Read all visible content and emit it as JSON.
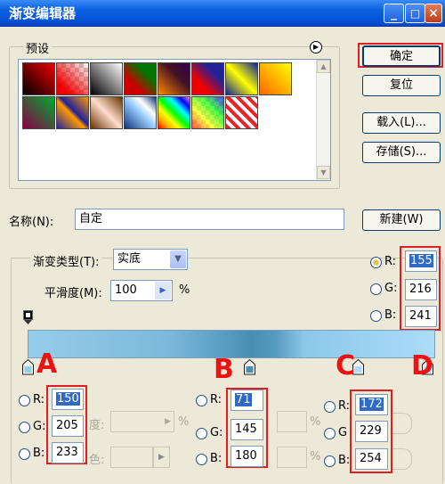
{
  "window": {
    "title": "渐变编辑器",
    "controls": [
      "_",
      "□",
      "×"
    ]
  },
  "buttons": {
    "ok": "确定",
    "reset": "复位",
    "load": "载入(L)...",
    "save": "存储(S)...",
    "new": "新建(W)"
  },
  "presets": {
    "label": "预设"
  },
  "name": {
    "label": "名称(N):",
    "value": "自定"
  },
  "gradient_type": {
    "label": "渐变类型(T):",
    "value": "实底"
  },
  "smoothness": {
    "label": "平滑度(M):",
    "value": "100",
    "unit": "%"
  },
  "top_color": {
    "r": "155",
    "g": "216",
    "b": "241"
  },
  "stop_a": {
    "letter": "A",
    "r": "150",
    "g": "205",
    "b": "233"
  },
  "stop_b": {
    "letter": "B",
    "r": "71",
    "g": "145",
    "b": "180"
  },
  "stop_c": {
    "letter": "C",
    "r": "172",
    "g": "229",
    "b": "254"
  },
  "stop_d": {
    "letter": "D"
  },
  "channel_labels": {
    "r": "R:",
    "g": "G:",
    "b": "B:",
    "g_short": "G",
    "b_short": "B:"
  },
  "disabled": {
    "opacity_frag": "度:",
    "color_frag": "色:",
    "percent": "%",
    "percent2": "%",
    "percent3": "%"
  }
}
